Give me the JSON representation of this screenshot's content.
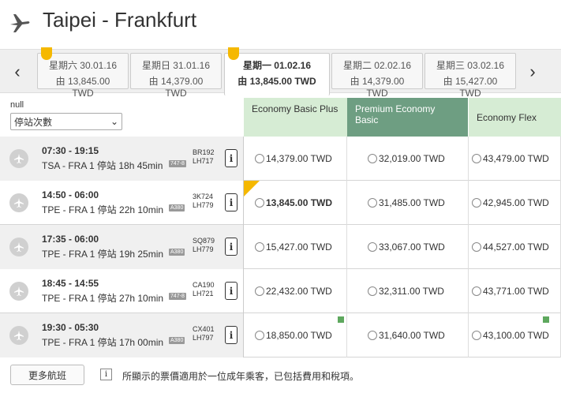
{
  "header": {
    "title": "Taipei - Frankfurt"
  },
  "date_strip": {
    "tabs": [
      {
        "day": "星期六 30.01.16",
        "price": "由 13,845.00 TWD",
        "selected": false,
        "tag": true
      },
      {
        "day": "星期日 31.01.16",
        "price": "由 14,379.00 TWD",
        "selected": false,
        "tag": false
      },
      {
        "day": "星期一 01.02.16",
        "price": "由 13,845.00 TWD",
        "selected": true,
        "tag": true
      },
      {
        "day": "星期二 02.02.16",
        "price": "由 14,379.00 TWD",
        "selected": false,
        "tag": false
      },
      {
        "day": "星期三 03.02.16",
        "price": "由 15,427.00 TWD",
        "selected": false,
        "tag": false
      }
    ],
    "prev_icon": "chevron-left-icon",
    "next_icon": "chevron-right-icon"
  },
  "filter": {
    "label": "null",
    "select_value": "停站次數"
  },
  "fare_headers": {
    "basic": "Economy Basic Plus",
    "premium": "Premium Economy Basic",
    "flex": "Economy Flex"
  },
  "flights": [
    {
      "times": "07:30 - 19:15",
      "route": "TSA - FRA  1 停站  18h 45min",
      "aircraft": "747-8",
      "code1": "BR192",
      "code2": "LH717",
      "fare1": "14,379.00 TWD",
      "fare2": "32,019.00 TWD",
      "fare3": "43,479.00 TWD"
    },
    {
      "times": "14:50 - 06:00",
      "route": "TPE - FRA  1 停站  22h 10min",
      "aircraft": "A380",
      "code1": "3K724",
      "code2": "LH779",
      "fare1": "13,845.00 TWD",
      "fare2": "31,485.00 TWD",
      "fare3": "42,945.00 TWD"
    },
    {
      "times": "17:35 - 06:00",
      "route": "TPE - FRA  1 停站  19h 25min",
      "aircraft": "A380",
      "code1": "SQ879",
      "code2": "LH779",
      "fare1": "15,427.00 TWD",
      "fare2": "33,067.00 TWD",
      "fare3": "44,527.00 TWD"
    },
    {
      "times": "18:45 - 14:55",
      "route": "TPE - FRA  1 停站  27h 10min",
      "aircraft": "747-8",
      "code1": "CA190",
      "code2": "LH721",
      "fare1": "22,432.00 TWD",
      "fare2": "32,311.00 TWD",
      "fare3": "43,771.00 TWD"
    },
    {
      "times": "19:30 - 05:30",
      "route": "TPE - FRA  1 停站  17h 00min",
      "aircraft": "A380",
      "code1": "CX401",
      "code2": "LH797",
      "fare1": "18,850.00 TWD",
      "fare2": "31,640.00 TWD",
      "fare3": "43,100.00 TWD"
    }
  ],
  "footer": {
    "more_button": "更多航班",
    "note_icon": "i",
    "note": "所顯示的票價適用於一位成年乘客，已包括費用和稅項。"
  },
  "colors": {
    "accent": "#f5b800",
    "green_light": "#d6ecd4",
    "green_dark": "#6e9e82",
    "badge_green": "#5ea85e"
  }
}
